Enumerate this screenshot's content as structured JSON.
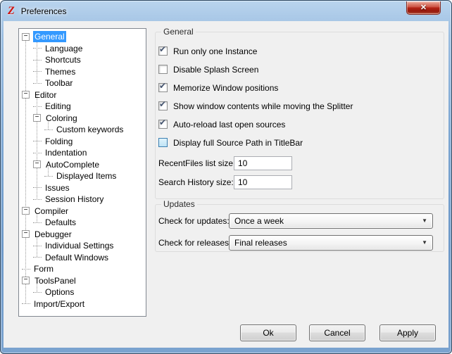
{
  "window": {
    "title": "Preferences"
  },
  "icons": {
    "app": "Z",
    "close": "✕",
    "tree_collapse": "−",
    "check": "✔",
    "combo_arrow": "▼"
  },
  "colors": {
    "selection_blue": "#3399FF",
    "titlebar_blue": "#7FA8D3",
    "close_button_red": "#B42516",
    "client_background": "#F0F0F0",
    "hot_checkbox_border": "#3C7FB1"
  },
  "tree": {
    "items": [
      {
        "label": "General",
        "level": 0,
        "expander": true,
        "selected": true
      },
      {
        "label": "Language",
        "level": 1,
        "expander": false
      },
      {
        "label": "Shortcuts",
        "level": 1,
        "expander": false
      },
      {
        "label": "Themes",
        "level": 1,
        "expander": false
      },
      {
        "label": "Toolbar",
        "level": 1,
        "expander": false
      },
      {
        "label": "Editor",
        "level": 0,
        "expander": true
      },
      {
        "label": "Editing",
        "level": 1,
        "expander": false
      },
      {
        "label": "Coloring",
        "level": 1,
        "expander": true
      },
      {
        "label": "Custom keywords",
        "level": 2,
        "expander": false
      },
      {
        "label": "Folding",
        "level": 1,
        "expander": false
      },
      {
        "label": "Indentation",
        "level": 1,
        "expander": false
      },
      {
        "label": "AutoComplete",
        "level": 1,
        "expander": true
      },
      {
        "label": "Displayed Items",
        "level": 2,
        "expander": false
      },
      {
        "label": "Issues",
        "level": 1,
        "expander": false
      },
      {
        "label": "Session History",
        "level": 1,
        "expander": false
      },
      {
        "label": "Compiler",
        "level": 0,
        "expander": true
      },
      {
        "label": "Defaults",
        "level": 1,
        "expander": false
      },
      {
        "label": "Debugger",
        "level": 0,
        "expander": true
      },
      {
        "label": "Individual Settings",
        "level": 1,
        "expander": false
      },
      {
        "label": "Default Windows",
        "level": 1,
        "expander": false
      },
      {
        "label": "Form",
        "level": 0,
        "expander": false
      },
      {
        "label": "ToolsPanel",
        "level": 0,
        "expander": true
      },
      {
        "label": "Options",
        "level": 1,
        "expander": false
      },
      {
        "label": "Import/Export",
        "level": 0,
        "expander": false
      }
    ]
  },
  "general_group": {
    "title": "General",
    "checkboxes": [
      {
        "label": "Run only one Instance",
        "checked": true
      },
      {
        "label": "Disable Splash Screen",
        "checked": false
      },
      {
        "label": "Memorize Window positions",
        "checked": true
      },
      {
        "label": "Show window contents while moving the Splitter",
        "checked": true
      },
      {
        "label": "Auto-reload last open sources",
        "checked": true
      },
      {
        "label": "Display full Source Path in TitleBar",
        "checked": false,
        "hot": true
      }
    ],
    "fields": [
      {
        "label": "RecentFiles list size:",
        "value": "10"
      },
      {
        "label": "Search History size:",
        "value": "10"
      }
    ]
  },
  "updates_group": {
    "title": "Updates",
    "dropdowns": [
      {
        "label": "Check for updates:",
        "value": "Once a week"
      },
      {
        "label": "Check for releases:",
        "value": "Final releases"
      }
    ]
  },
  "buttons": {
    "ok": "Ok",
    "cancel": "Cancel",
    "apply": "Apply"
  }
}
